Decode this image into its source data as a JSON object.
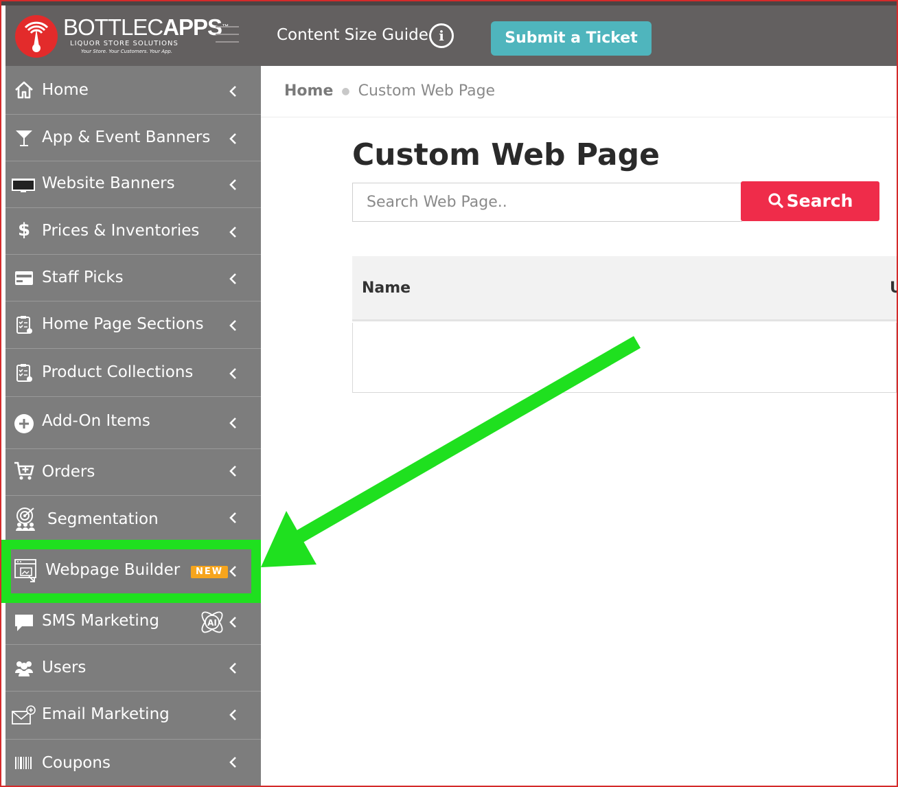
{
  "header": {
    "logo": {
      "name": "BOTTLECAPPS",
      "name_light": "BOTTLEC",
      "name_bold": "APPS",
      "tm": "™",
      "subtitle": "LIQUOR STORE SOLUTIONS",
      "tagline": "Your Store. Your Customers. Your App."
    },
    "size_guide_label": "Content Size Guide",
    "info_glyph": "i",
    "ticket_button": "Submit a Ticket"
  },
  "sidebar": {
    "items": [
      {
        "label": "Home",
        "icon": "home-icon"
      },
      {
        "label": "App & Event Banners",
        "icon": "cocktail-icon"
      },
      {
        "label": "Website Banners",
        "icon": "monitor-icon"
      },
      {
        "label": "Prices & Inventories",
        "icon": "dollar-icon"
      },
      {
        "label": "Staff Picks",
        "icon": "card-icon"
      },
      {
        "label": "Home Page Sections",
        "icon": "clipboard-icon"
      },
      {
        "label": "Product Collections",
        "icon": "clipboard-icon"
      },
      {
        "label": "Add-On Items",
        "icon": "plus-circle-icon"
      },
      {
        "label": "Orders",
        "icon": "cart-icon"
      },
      {
        "label": "Segmentation",
        "icon": "target-users-icon"
      },
      {
        "label": "Webpage Builder",
        "icon": "webpage-builder-icon",
        "badge": "NEW"
      },
      {
        "label": "SMS Marketing",
        "icon": "chat-icon",
        "badge_icon": "ai-icon"
      },
      {
        "label": "Users",
        "icon": "users-icon"
      },
      {
        "label": "Email Marketing",
        "icon": "email-icon"
      },
      {
        "label": "Coupons",
        "icon": "barcode-icon"
      }
    ]
  },
  "main": {
    "breadcrumb": {
      "home": "Home",
      "current": "Custom Web Page"
    },
    "title": "Custom Web Page",
    "search": {
      "placeholder": "Search Web Page..",
      "button": "Search"
    },
    "table": {
      "columns": [
        "Name",
        "U"
      ]
    }
  },
  "colors": {
    "header": "#636060",
    "sidebar": "#7d7d7d",
    "ticket": "#4fb5bd",
    "search": "#ef2c4a",
    "new_badge": "#f6a51d",
    "highlight": "#1fe01f"
  }
}
